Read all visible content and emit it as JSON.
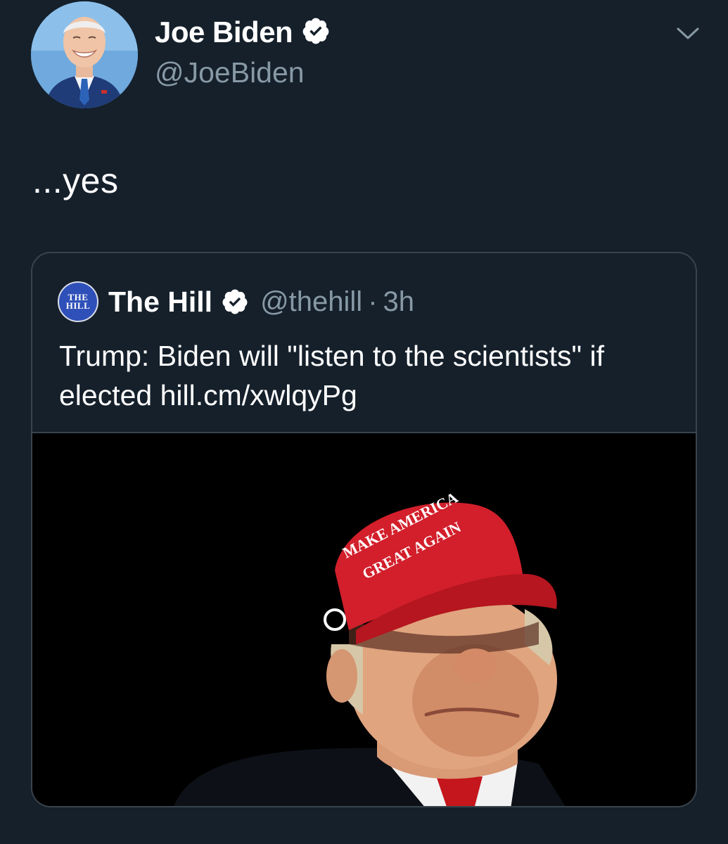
{
  "author": {
    "name": "Joe Biden",
    "handle": "@JoeBiden",
    "verified_icon": "verified-badge-icon",
    "avatar_bg": "#6fa9dd"
  },
  "tweet": {
    "text": "...yes"
  },
  "quote": {
    "logo_lines": [
      "THE",
      "HILL"
    ],
    "name": "The Hill",
    "handle": "@thehill",
    "separator": "·",
    "time": "3h",
    "text": "Trump: Biden will \"listen to the scientists\" if elected hill.cm/xwlqyPg",
    "media": {
      "hat_text_line1": "MAKE AMERICA",
      "hat_text_line2": "GREAT AGAIN",
      "hat_color": "#d21f2b"
    }
  },
  "theme": {
    "background": "#15202b",
    "secondary_text": "#8899a6",
    "border": "#38444d"
  }
}
